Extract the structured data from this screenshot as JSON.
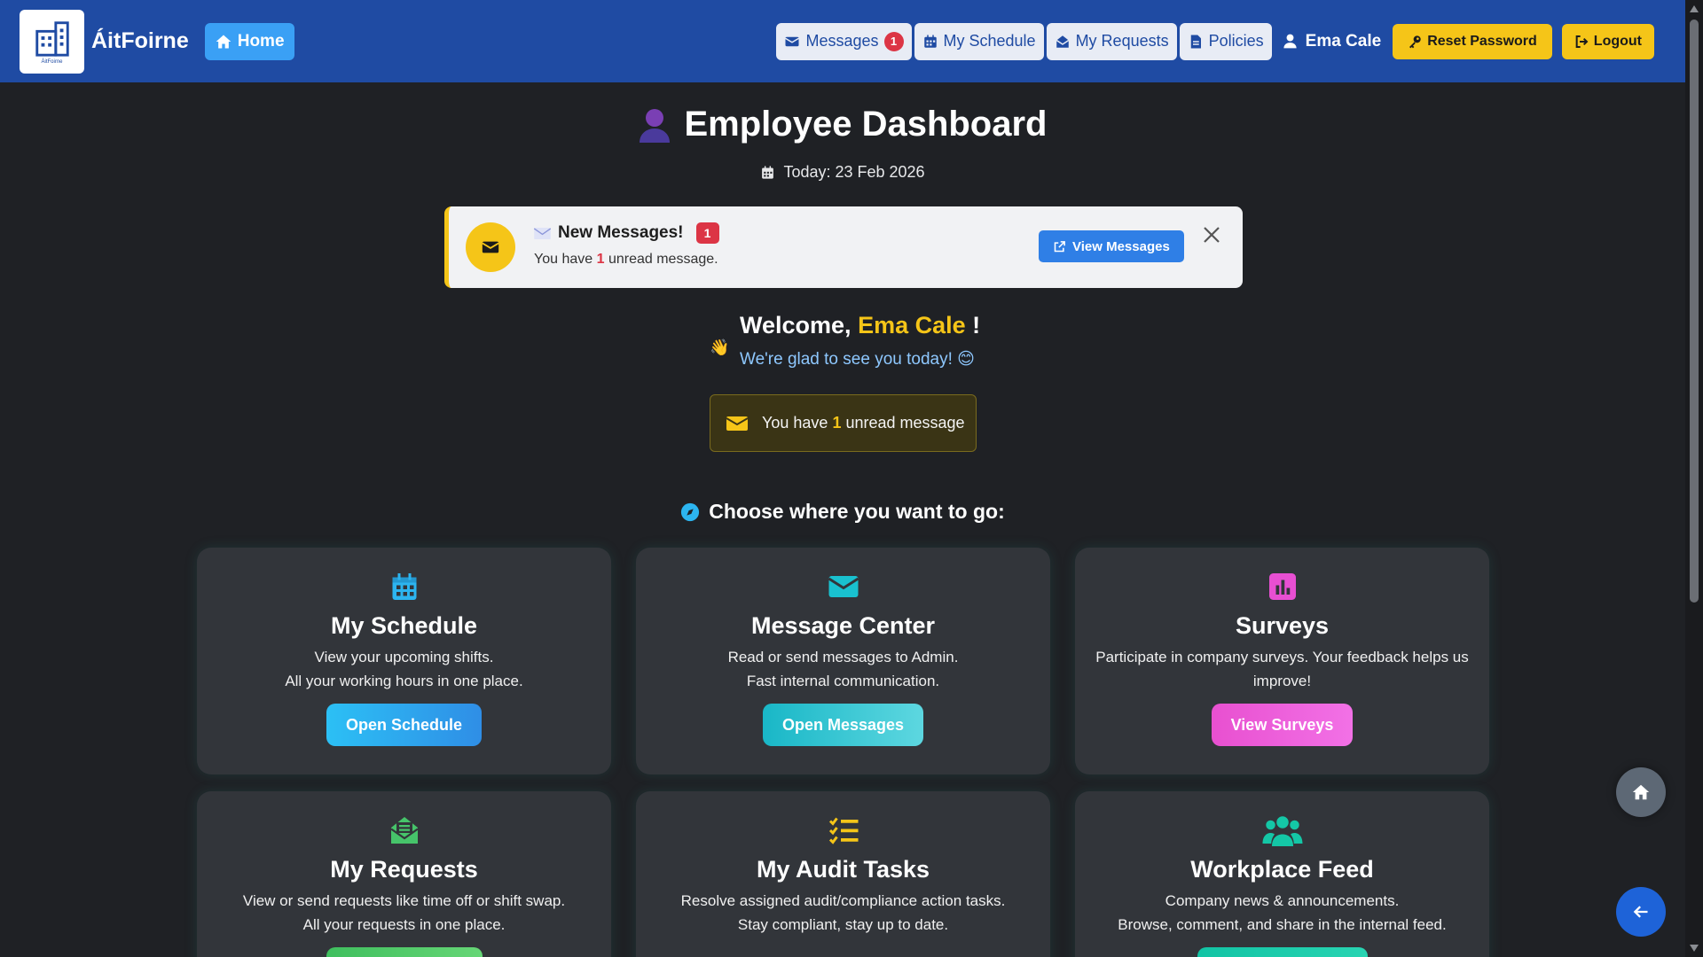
{
  "navbar": {
    "logo_caption": "ÁitFoirne",
    "brand": "ÁitFoirne",
    "home_label": "Home",
    "messages_label": "Messages",
    "messages_count": "1",
    "schedule_label": "My Schedule",
    "requests_label": "My Requests",
    "policies_label": "Policies",
    "user_name": "Ema Cale",
    "reset_password_label": "Reset Password",
    "logout_label": "Logout"
  },
  "header": {
    "title": "Employee Dashboard",
    "today": "Today: 23 Feb 2026"
  },
  "alert": {
    "title": "New Messages!",
    "badge": "1",
    "text_before": "You have",
    "count": "1",
    "text_after": "unread message.",
    "view_label": "View Messages"
  },
  "welcome": {
    "wave": "👋",
    "greeting": "Welcome,",
    "name": "Ema Cale",
    "exclaim": "!",
    "subtitle": "We're glad to see you today! 😊"
  },
  "unread_box": {
    "before": "You have",
    "count": "1",
    "after": "unread message"
  },
  "choose": "Choose where you want to go:",
  "cards": [
    {
      "title": "My Schedule",
      "line1": "View your upcoming shifts.",
      "line2": "All your working hours in one place.",
      "button": "Open Schedule",
      "icon": "calendar-icon",
      "color": "#2cb5f0"
    },
    {
      "title": "Message Center",
      "line1": "Read or send messages to Admin.",
      "line2": "Fast internal communication.",
      "button": "Open Messages",
      "icon": "envelope-icon",
      "color": "#19c1cf"
    },
    {
      "title": "Surveys",
      "line1": "Participate in company surveys. Your feedback helps us improve!",
      "button": "View Surveys",
      "icon": "chart-square-icon",
      "color": "#e84fd2"
    },
    {
      "title": "My Requests",
      "line1": "View or send requests like time off or shift swap.",
      "line2": "All your requests in one place.",
      "icon": "envelope-open-icon",
      "color": "#46c46a"
    },
    {
      "title": "My Audit Tasks",
      "line1": "Resolve assigned audit/compliance action tasks.",
      "line2": "Stay compliant, stay up to date.",
      "icon": "checklist-icon",
      "color": "#f5c518"
    },
    {
      "title": "Workplace Feed",
      "line1": "Company news & announcements.",
      "line2": "Browse, comment, and share in the internal feed.",
      "icon": "users-icon",
      "color": "#14c7a6"
    }
  ],
  "colors": {
    "navbar": "#1f4ba3",
    "background": "#1f2125",
    "accent_gold": "#f5c518",
    "badge_red": "#dc3545",
    "card": "#32353a"
  }
}
